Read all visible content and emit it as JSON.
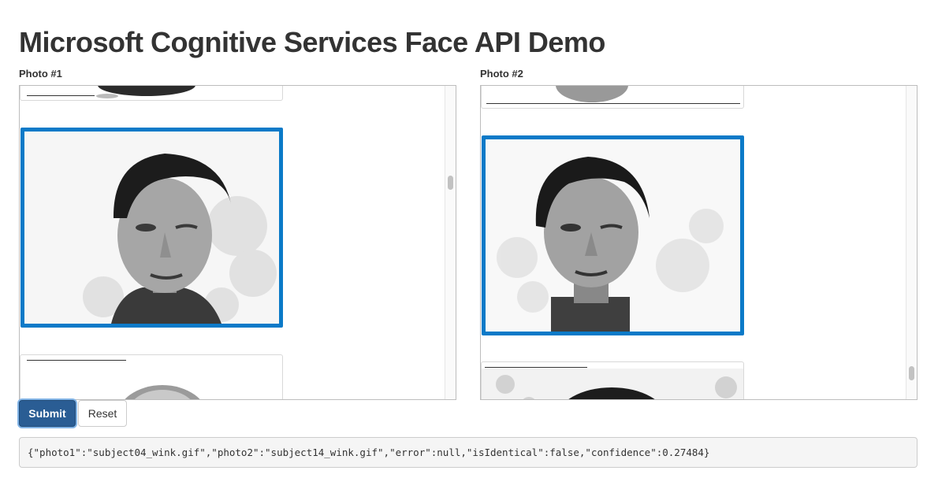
{
  "page": {
    "title": "Microsoft Cognitive Services Face API Demo"
  },
  "photo1": {
    "label": "Photo #1"
  },
  "photo2": {
    "label": "Photo #2"
  },
  "actions": {
    "submit_label": "Submit",
    "reset_label": "Reset"
  },
  "result": {
    "json": "{\"photo1\":\"subject04_wink.gif\",\"photo2\":\"subject14_wink.gif\",\"error\":null,\"isIdentical\":false,\"confidence\":0.27484}"
  },
  "colors": {
    "selection_border": "#0b7ac8",
    "primary_button": "#2a5d94",
    "result_background": "#f5f5f5"
  }
}
